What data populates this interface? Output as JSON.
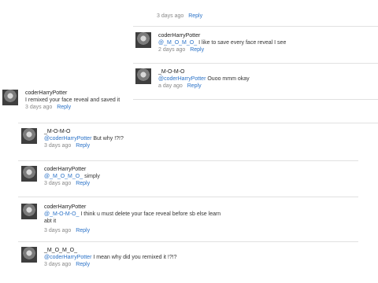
{
  "top_partial": {
    "time": "3 days ago",
    "reply": "Reply"
  },
  "comments": [
    {
      "user": "coderHarryPotter",
      "mention": "@_M_O_M_O_",
      "text": " I like to save every face reveal I see",
      "time": "2 days ago",
      "reply": "Reply"
    },
    {
      "user": "_M-O-M-O",
      "mention": "@coderHarryPotter",
      "text": " Ouoo mmm okay",
      "time": "a day ago",
      "reply": "Reply"
    },
    {
      "user": "coderHarryPotter",
      "mention": "",
      "text": "I remixed your face reveal and saved it",
      "time": "3 days ago",
      "reply": "Reply"
    },
    {
      "user": "_M-O-M-O",
      "mention": "@coderHarryPotter",
      "text": " But why !?!?",
      "time": "3 days ago",
      "reply": "Reply"
    },
    {
      "user": "coderHarryPotter",
      "mention": "@_M_O_M_O_",
      "text": " simply",
      "time": "3 days ago",
      "reply": "Reply"
    },
    {
      "user": "coderHarryPotter",
      "mention": "@_M-O-M-O_",
      "text": " I think u must delete your face reveal before sb else learn abt it",
      "time": "3 days ago",
      "reply": "Reply"
    },
    {
      "user": "_M_O_M_O_",
      "mention": "@coderHarryPotter",
      "text": " I mean why did you remixed it !?!?",
      "time": "3 days ago",
      "reply": "Reply"
    }
  ]
}
